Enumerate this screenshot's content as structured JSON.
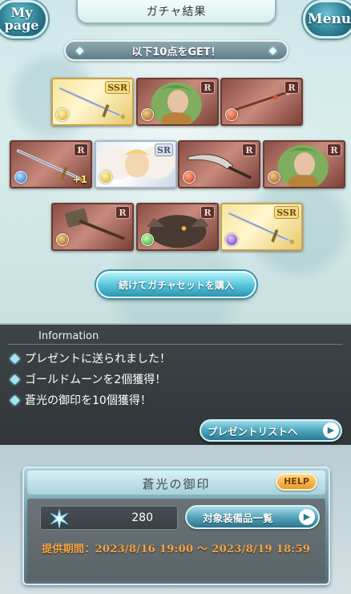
{
  "header": {
    "title": "ガチャ結果",
    "mypage_label_1": "My",
    "mypage_label_2": "page",
    "menu_label": "Menu"
  },
  "banner": {
    "text": "以下10点をGET！"
  },
  "cards": [
    {
      "rarity": "SSR",
      "element": "light",
      "item": "sword"
    },
    {
      "rarity": "R",
      "element": "earth",
      "item": "green-haired-character"
    },
    {
      "rarity": "R",
      "element": "fire",
      "item": "spear"
    },
    {
      "rarity": "R",
      "element": "water",
      "item": "sword",
      "plus": "+1"
    },
    {
      "rarity": "SR",
      "element": "light",
      "item": "winged-summon"
    },
    {
      "rarity": "R",
      "element": "fire",
      "item": "curved-blade"
    },
    {
      "rarity": "R",
      "element": "earth",
      "item": "green-haired-character"
    },
    {
      "rarity": "R",
      "element": "earth",
      "item": "hammer"
    },
    {
      "rarity": "R",
      "element": "wind",
      "item": "beast-summon"
    },
    {
      "rarity": "SSR",
      "element": "dark",
      "item": "sword"
    }
  ],
  "buy_button": {
    "label": "続けてガチャセットを購入"
  },
  "information": {
    "title": "Information",
    "lines": [
      "プレゼントに送られました！",
      "ゴールドムーンを2個獲得！",
      "蒼光の御印を10個獲得！"
    ],
    "present_button": "プレゼントリストへ"
  },
  "seal": {
    "title": "蒼光の御印",
    "help_label": "HELP",
    "count": "280",
    "equip_button": "対象装備品一覧",
    "period": "提供期間：2023/8/16 19:00 ～ 2023/8/19 18:59"
  },
  "colors": {
    "accent_cyan": "#5cc8dd",
    "info_bg": "#3d4447",
    "period_orange": "#f3a64a",
    "help_orange": "#e79a2a"
  }
}
